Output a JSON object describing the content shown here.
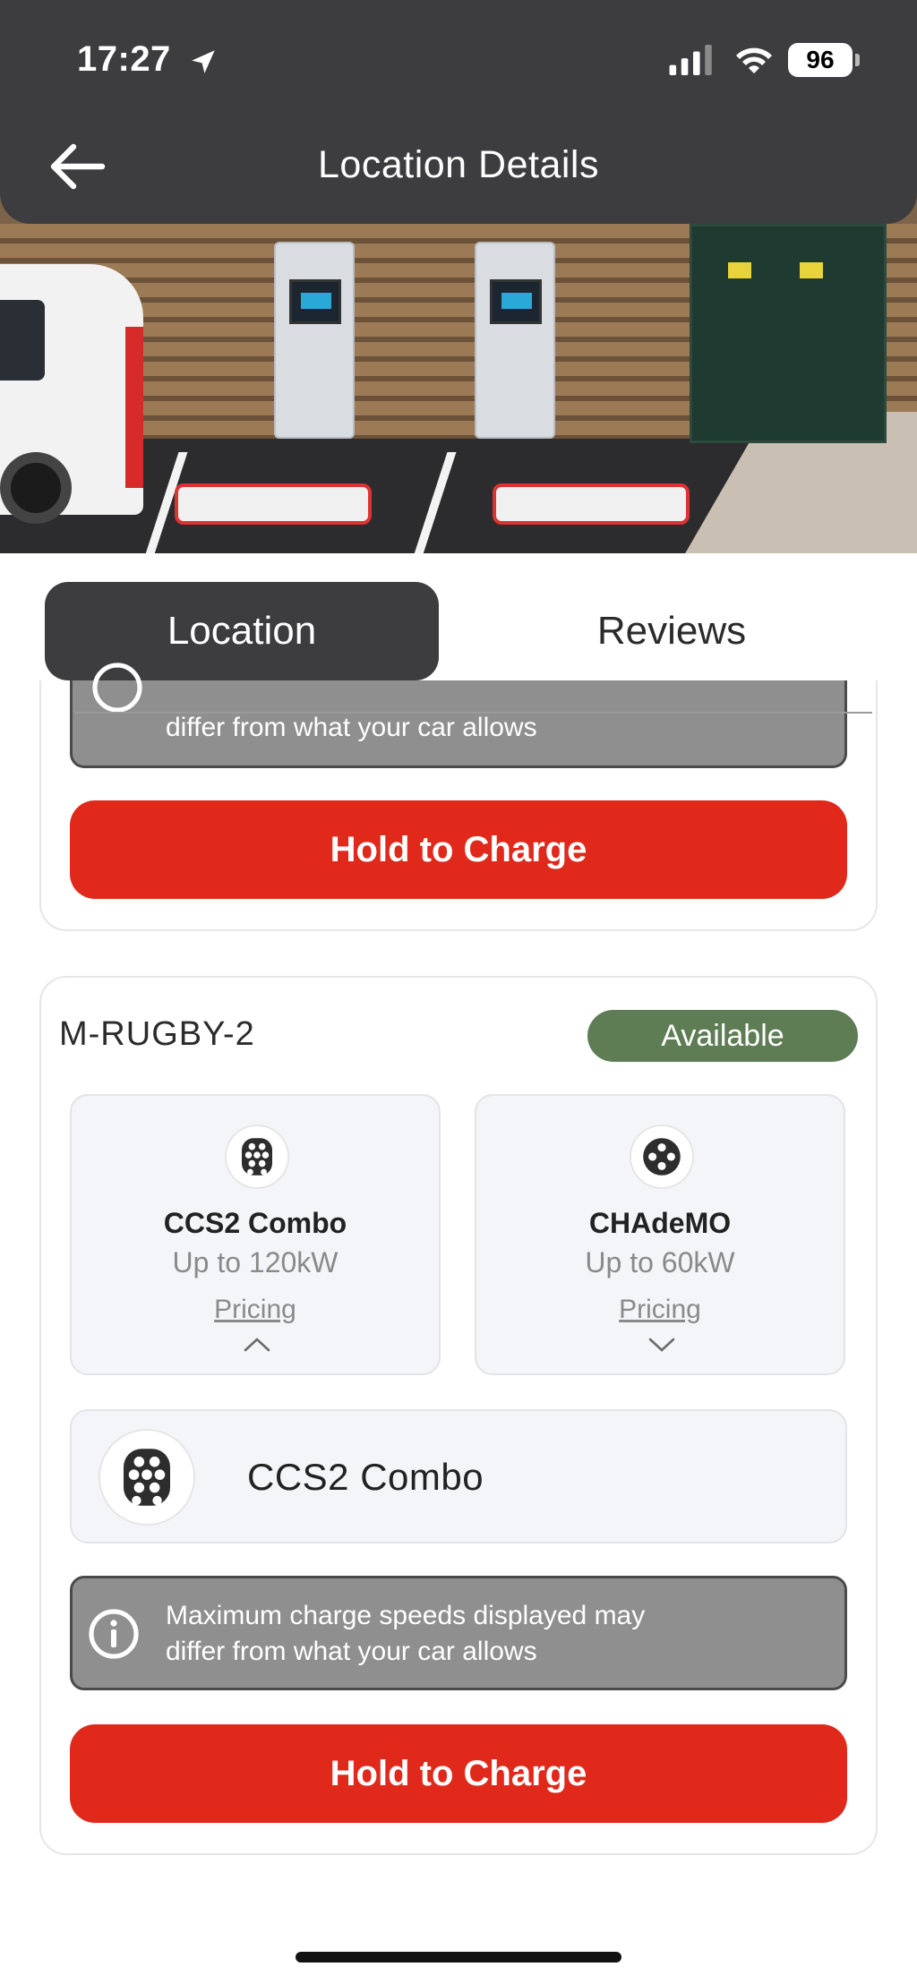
{
  "status_bar": {
    "time": "17:27",
    "battery": "96",
    "icons": [
      "location-arrow-icon",
      "cellular-signal-icon",
      "wifi-icon",
      "battery-icon"
    ]
  },
  "header": {
    "title": "Location Details",
    "back_icon": "back-arrow-icon"
  },
  "tabs": [
    {
      "label": "Location",
      "active": true
    },
    {
      "label": "Reviews",
      "active": false
    }
  ],
  "previous_station": {
    "notice_text": "differ from what your car allows",
    "charge_button": "Hold to Charge"
  },
  "station": {
    "name": "M-RUGBY-2",
    "status": "Available",
    "status_color": "#5e7d55",
    "connectors": [
      {
        "name": "CCS2 Combo",
        "power": "Up to 120kW",
        "pricing": "Pricing",
        "expanded": true,
        "icon": "ccs2-plug-icon"
      },
      {
        "name": "CHAdeMO",
        "power": "Up to 60kW",
        "pricing": "Pricing",
        "expanded": false,
        "icon": "chademo-plug-icon"
      }
    ],
    "selected_connector": "CCS2 Combo",
    "notice_line1": "Maximum  charge speeds displayed may",
    "notice_line2": "differ from what your car allows",
    "charge_button": "Hold to Charge"
  },
  "colors": {
    "header_bg": "#3d3d3f",
    "accent_red": "#e0281b",
    "notice_bg": "#8f8f8f"
  }
}
